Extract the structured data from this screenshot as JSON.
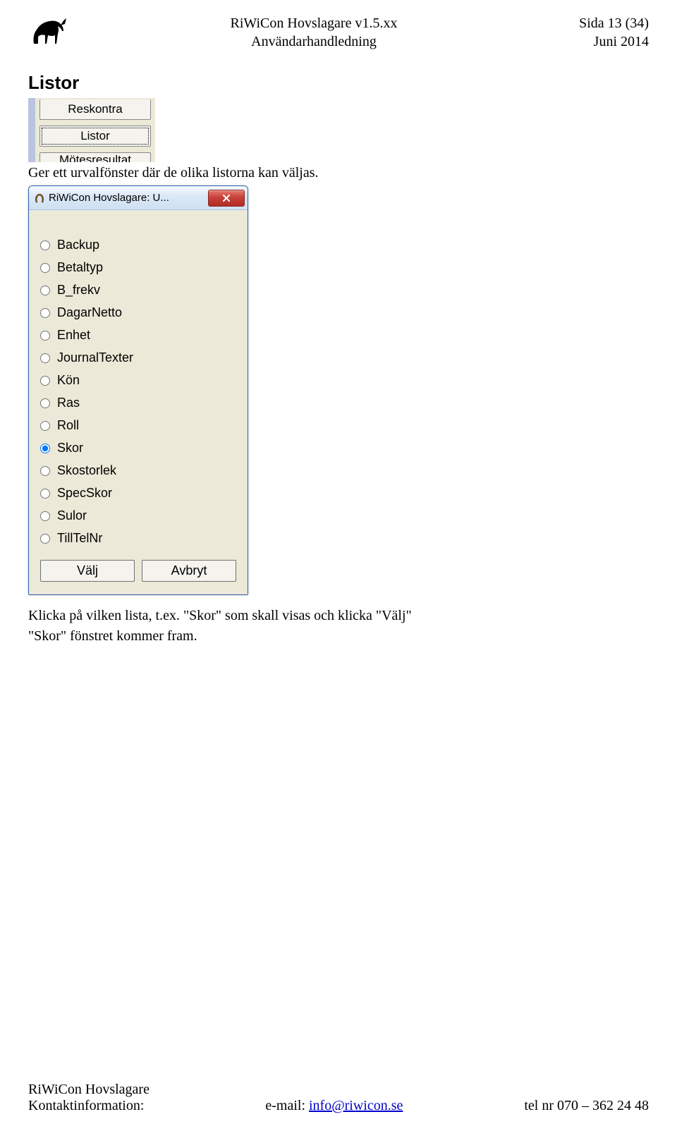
{
  "header": {
    "title_line1": "RiWiCon Hovslagare v1.5.xx",
    "title_line2": "Användarhandledning",
    "page_info": "Sida 13 (34)",
    "date": "Juni 2014"
  },
  "section_heading": "Listor",
  "sidebar_buttons": {
    "top_partial": "Reskontra",
    "focused": "Listor",
    "bottom_partial": "Mötesresultat"
  },
  "intro_text": "Ger ett urvalfönster där de olika listorna kan väljas.",
  "dialog": {
    "title": "RiWiCon Hovslagare: U...",
    "options": [
      {
        "label": "Backup",
        "selected": false
      },
      {
        "label": "Betaltyp",
        "selected": false
      },
      {
        "label": "B_frekv",
        "selected": false
      },
      {
        "label": "DagarNetto",
        "selected": false
      },
      {
        "label": "Enhet",
        "selected": false
      },
      {
        "label": "JournalTexter",
        "selected": false
      },
      {
        "label": "Kön",
        "selected": false
      },
      {
        "label": "Ras",
        "selected": false
      },
      {
        "label": "Roll",
        "selected": false
      },
      {
        "label": "Skor",
        "selected": true
      },
      {
        "label": "Skostorlek",
        "selected": false
      },
      {
        "label": "SpecSkor",
        "selected": false
      },
      {
        "label": "Sulor",
        "selected": false
      },
      {
        "label": "TillTelNr",
        "selected": false
      }
    ],
    "ok_label": "Välj",
    "cancel_label": "Avbryt"
  },
  "post_text_line1": "Klicka på vilken lista, t.ex. \"Skor\" som skall visas och klicka \"Välj\"",
  "post_text_line2": "\"Skor\" fönstret kommer fram.",
  "footer": {
    "company": "RiWiCon Hovslagare",
    "contact_label": "Kontaktinformation:",
    "email_label": "e-mail: ",
    "email": "info@riwicon.se",
    "phone": "tel nr 070 – 362 24 48"
  }
}
